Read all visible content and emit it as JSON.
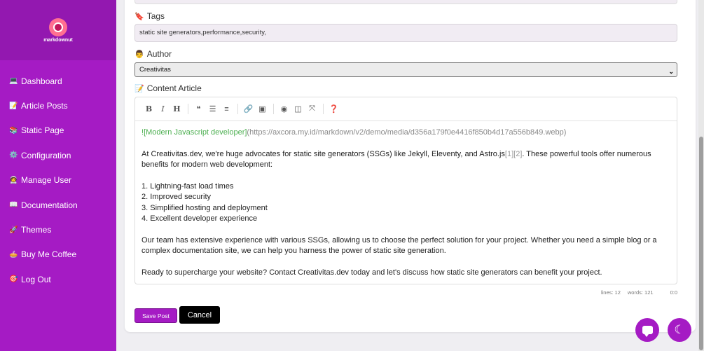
{
  "brand": {
    "name": "markdownut",
    "accent": "#a51bc4"
  },
  "sidebar": {
    "items": [
      {
        "icon": "💻",
        "icon_name": "laptop-icon",
        "label": "Dashboard"
      },
      {
        "icon": "📝",
        "icon_name": "memo-icon",
        "label": "Article Posts"
      },
      {
        "icon": "📚",
        "icon_name": "books-icon",
        "label": "Static Page"
      },
      {
        "icon": "⚙️",
        "icon_name": "gear-icon",
        "label": "Configuration"
      },
      {
        "icon": "🧑‍🚀",
        "icon_name": "user-icon",
        "label": "Manage User"
      },
      {
        "icon": "📖",
        "icon_name": "book-icon",
        "label": "Documentation"
      },
      {
        "icon": "🚀",
        "icon_name": "rocket-icon",
        "label": "Themes"
      },
      {
        "icon": "🥧",
        "icon_name": "coffee-icon",
        "label": "Buy Me Coffee"
      },
      {
        "icon": "🎯",
        "icon_name": "logout-icon",
        "label": "Log Out"
      }
    ]
  },
  "form": {
    "tags_label": "Tags",
    "tags_icon": "🔖",
    "tags_value": "static site generators,performance,security,",
    "author_label": "Author",
    "author_icon": "👨",
    "author_value": "Creativitas",
    "content_label": "Content Article",
    "content_icon": "📝"
  },
  "editor": {
    "toolbar": [
      "bold",
      "italic",
      "heading",
      "quote",
      "unordered-list",
      "ordered-list",
      "link",
      "image",
      "preview",
      "side-by-side",
      "fullscreen",
      "guide"
    ],
    "image_prefix": "!",
    "image_alt": "[Modern Javascript developer]",
    "image_url": "(https://axcora.my.id/markdown/v2/demo/media/d356a179f0e4416f850b4d17a556b849.webp)",
    "para1_start": "At Creativitas.dev, we're huge advocates for static site generators (SSGs) like Jekyll, Eleventy, and Astro.js",
    "para1_ref1": "[1]",
    "para1_ref2": "[2]",
    "para1_end": ". These powerful tools offer numerous benefits for modern web development:",
    "list": [
      "1. Lightning-fast load times",
      "2. Improved security",
      "3. Simplified hosting and deployment",
      "4. Excellent developer experience"
    ],
    "para2": "Our team has extensive experience with various SSGs, allowing us to choose the perfect solution for your project. Whether you need a simple blog or a complex documentation site, we can help you harness the power of static site generation.",
    "para3": "Ready to supercharge your website? Contact Creativitas.dev today and let's discuss how static site generators can benefit your project."
  },
  "status": {
    "lines": "lines: 12",
    "words": "words: 121",
    "cursor": "0:0"
  },
  "buttons": {
    "save": "Save Post",
    "cancel": "Cancel"
  }
}
